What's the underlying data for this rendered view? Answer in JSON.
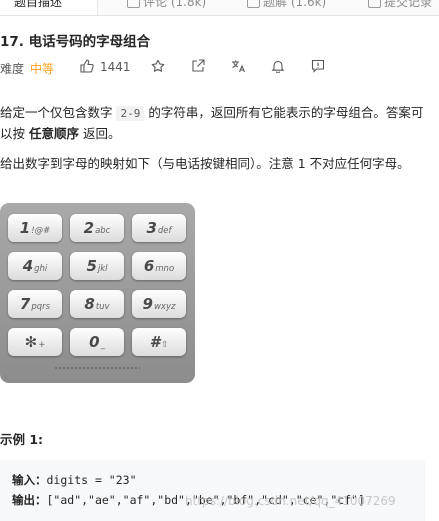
{
  "tabs": [
    {
      "label": "题目描述"
    },
    {
      "label": "评论 (1.8k)"
    },
    {
      "label": "题解 (1.6k)"
    },
    {
      "label": "提交记录"
    }
  ],
  "problem": {
    "title": "17. 电话号码的字母组合",
    "difficulty_label": "难度",
    "difficulty": "中等",
    "likes": "1441",
    "difficulty_color": "#ffa116"
  },
  "description": {
    "p1_a": "给定一个仅包含数字 ",
    "p1_code": "2-9",
    "p1_b": " 的字符串，返回所有它能表示的字母组合。答案可以按 ",
    "p1_bold": "任意顺序",
    "p1_c": " 返回。",
    "p2": "给出数字到字母的映射如下（与电话按键相同）。注意 1 不对应任何字母。"
  },
  "keypad": {
    "keys": [
      {
        "digit": "1",
        "letters": "!@#"
      },
      {
        "digit": "2",
        "letters": "abc"
      },
      {
        "digit": "3",
        "letters": "def"
      },
      {
        "digit": "4",
        "letters": "ghi"
      },
      {
        "digit": "5",
        "letters": "jkl"
      },
      {
        "digit": "6",
        "letters": "mno"
      },
      {
        "digit": "7",
        "letters": "pqrs"
      },
      {
        "digit": "8",
        "letters": "tuv"
      },
      {
        "digit": "9",
        "letters": "wxyz"
      },
      {
        "digit": "✻",
        "letters": "+"
      },
      {
        "digit": "0",
        "letters": "_"
      },
      {
        "digit": "#",
        "letters": "⇧"
      }
    ]
  },
  "example": {
    "title": "示例 1:",
    "input_label": "输入：",
    "input_value": "digits = \"23\"",
    "output_label": "输出：",
    "output_value": "[\"ad\",\"ae\",\"af\",\"bd\",\"be\",\"bf\",\"cd\",\"ce\",\"cf\"]"
  },
  "watermark": "https://blog.csdn.net/qq_41007269"
}
